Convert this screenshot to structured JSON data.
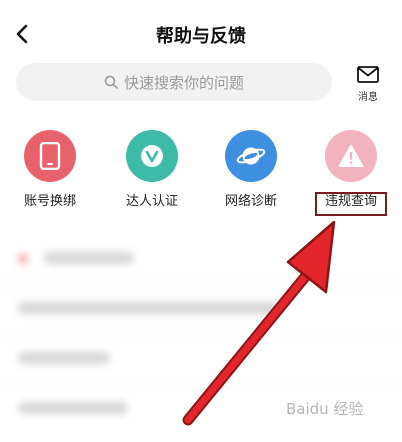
{
  "header": {
    "title": "帮助与反馈",
    "back_icon": "chevron-left-icon"
  },
  "search": {
    "placeholder": "快速搜索你的问题",
    "icon": "search-icon"
  },
  "messages": {
    "label": "消息",
    "icon": "mail-icon"
  },
  "entries": [
    {
      "label": "账号换绑",
      "icon": "phone-icon",
      "color": "#e8626b"
    },
    {
      "label": "达人认证",
      "icon": "v-badge-icon",
      "color": "#3dbba6"
    },
    {
      "label": "网络诊断",
      "icon": "planet-icon",
      "color": "#3f8fe0"
    },
    {
      "label": "违规查询",
      "icon": "warning-icon",
      "color": "#f2b3bf"
    }
  ],
  "annotation": {
    "highlight_color": "#7a1c1c",
    "arrow_color": "#e2262b"
  },
  "watermark": {
    "text": "Baidu 经验"
  }
}
